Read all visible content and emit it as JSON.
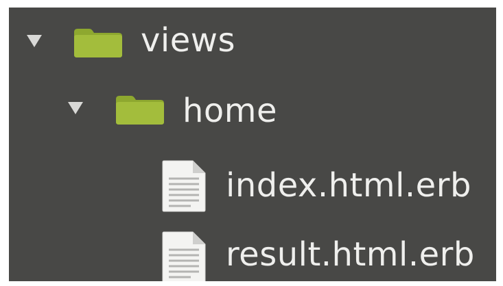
{
  "tree": {
    "items": [
      {
        "label": "views",
        "type": "folder",
        "expanded": true,
        "icon": "folder-icon",
        "depth": 0
      },
      {
        "label": "home",
        "type": "folder",
        "expanded": true,
        "icon": "folder-icon",
        "depth": 1
      },
      {
        "label": "index.html.erb",
        "type": "file",
        "icon": "file-icon",
        "depth": 2
      },
      {
        "label": "result.html.erb",
        "type": "file",
        "icon": "file-icon",
        "depth": 2
      }
    ]
  },
  "colors": {
    "background": "#484846",
    "folder": "#9ab536",
    "text": "#efefed",
    "twisty": "#d9d9d7"
  }
}
